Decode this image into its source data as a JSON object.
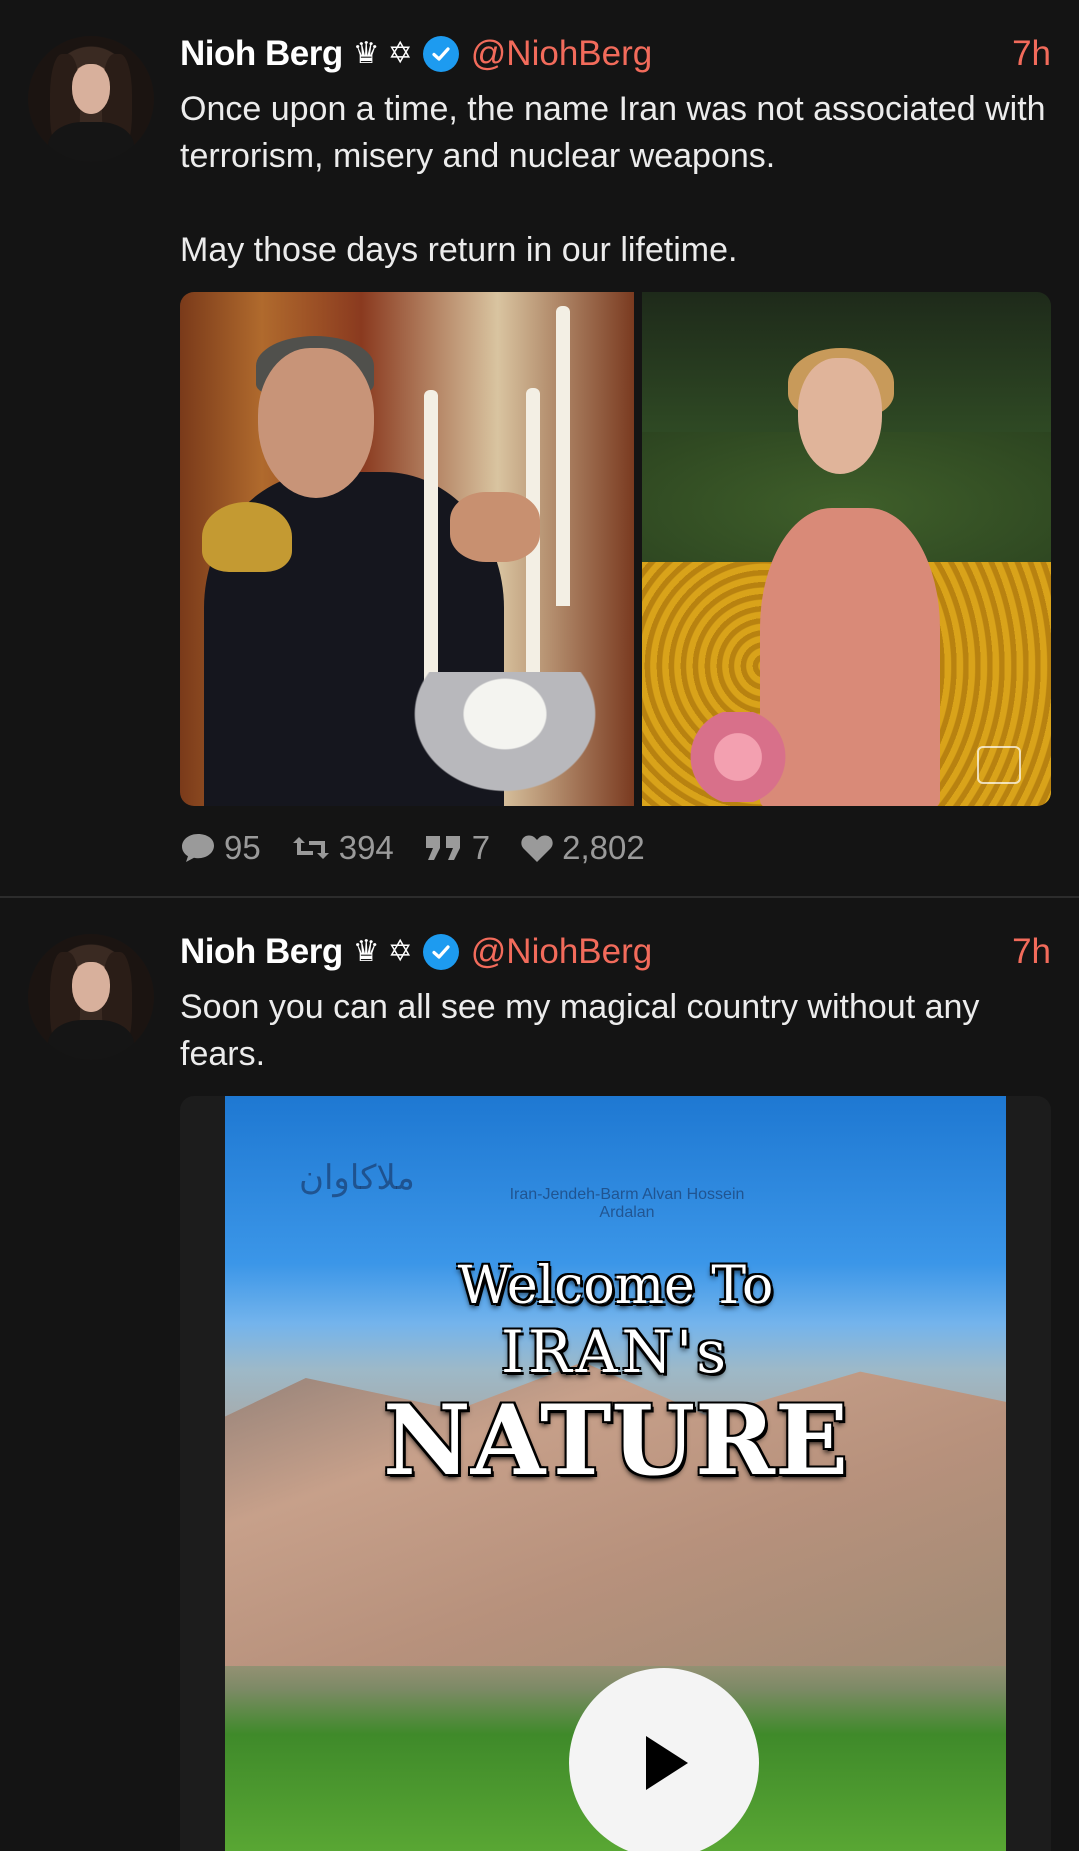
{
  "tweets": [
    {
      "author": {
        "name": "Nioh Berg",
        "emoji_1": "♛",
        "emoji_2": "✡",
        "handle": "@NiohBerg",
        "verified": true
      },
      "time": "7h",
      "text": "Once upon a time, the name Iran was not associated with terrorism, misery and nuclear weapons.\n\nMay those days return in our lifetime.",
      "media": {
        "type": "photos",
        "icons": [
          "photo-king-candles",
          "photo-queen-garden"
        ]
      },
      "stats": {
        "replies": "95",
        "retweets": "394",
        "quotes": "7",
        "likes": "2,802"
      }
    },
    {
      "author": {
        "name": "Nioh Berg",
        "emoji_1": "♛",
        "emoji_2": "✡",
        "handle": "@NiohBerg",
        "verified": true
      },
      "time": "7h",
      "text": "Soon you can all see my magical country without any fears.",
      "media": {
        "type": "video",
        "title_line_1": "Welcome To",
        "title_line_2": "IRAN's",
        "title_line_3": "NATURE",
        "play_icon": "play-icon"
      }
    }
  ],
  "colors": {
    "background": "#141414",
    "accent": "#f26b5b",
    "verified": "#1d9bf0",
    "stats": "#9a9a9a"
  }
}
